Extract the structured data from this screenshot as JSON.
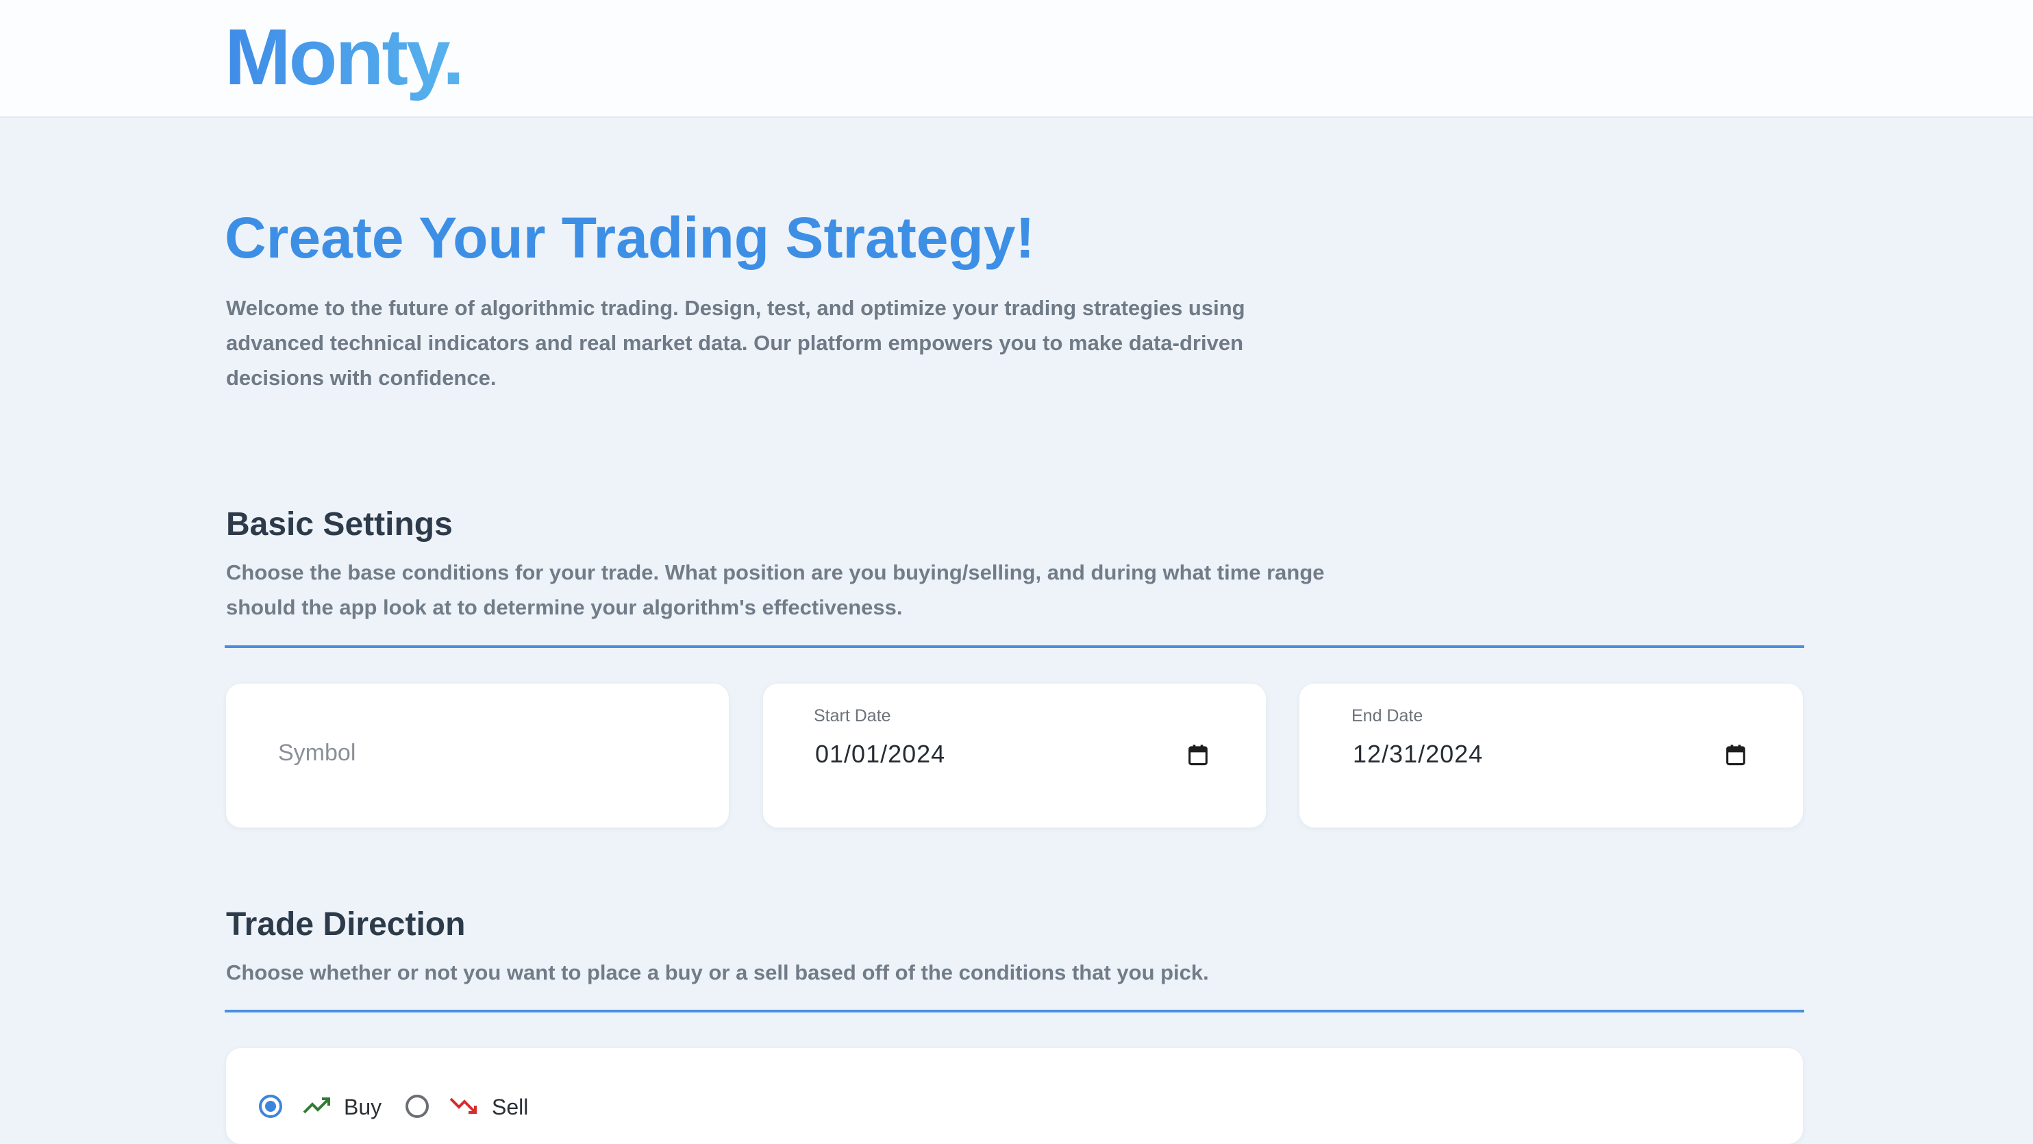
{
  "header": {
    "logo": "Monty."
  },
  "hero": {
    "title": "Create Your Trading Strategy!",
    "text": "Welcome to the future of algorithmic trading. Design, test, and optimize your trading strategies using advanced technical indicators and real market data. Our platform empowers you to make data-driven decisions with confidence."
  },
  "basic_settings": {
    "title": "Basic Settings",
    "description": "Choose the base conditions for your trade. What position are you buying/selling, and during what time range should the app look at to determine your algorithm's effectiveness.",
    "symbol": {
      "placeholder": "Symbol",
      "value": ""
    },
    "start_date": {
      "label": "Start Date",
      "value": "01/01/2024",
      "icon": "calendar-icon"
    },
    "end_date": {
      "label": "End Date",
      "value": "12/31/2024",
      "icon": "calendar-icon"
    }
  },
  "trade_direction": {
    "title": "Trade Direction",
    "description": "Choose whether or not you want to place a buy or a sell based off of the conditions that you pick.",
    "options": [
      {
        "label": "Buy",
        "selected": true,
        "icon": "trending-up-icon",
        "icon_color": "#2e7d32"
      },
      {
        "label": "Sell",
        "selected": false,
        "icon": "trending-down-icon",
        "icon_color": "#d32f2f"
      }
    ]
  },
  "colors": {
    "accent": "#3d8fe5",
    "background": "#edf3f8"
  }
}
